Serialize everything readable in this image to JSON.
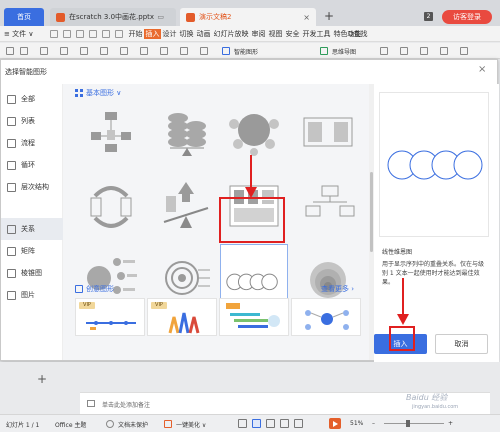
{
  "titlebar": {
    "tabs": [
      {
        "label": "首页"
      },
      {
        "label": "在scratch 3.0中画花.pptx"
      },
      {
        "label": "演示文稿2"
      }
    ],
    "badge": "2",
    "login": "访客登录"
  },
  "menubar": {
    "file": "≡ 文件 ∨",
    "tabs": [
      "开始",
      "插入",
      "设计",
      "切换",
      "动画",
      "幻灯片放映",
      "审阅",
      "视图",
      "安全",
      "开发工具",
      "特色功能"
    ],
    "search": "Q查找"
  },
  "toolbar": {
    "items": [
      "智能图形",
      "思维导图"
    ]
  },
  "dialog": {
    "title": "选择智能图形",
    "sidebar": [
      {
        "label": "全部"
      },
      {
        "label": "列表"
      },
      {
        "label": "流程"
      },
      {
        "label": "循环"
      },
      {
        "label": "层次结构"
      },
      {
        "label": "关系"
      },
      {
        "label": "矩阵"
      },
      {
        "label": "棱锥图"
      },
      {
        "label": "图片"
      }
    ],
    "basic_section": "基本图形 ∨",
    "creative_section": "创意图形",
    "see_more": "查看更多 ›",
    "vip": "VIP",
    "preview_title": "线性维恩图",
    "preview_desc": "用于显示序列中的重叠关系。仅在与级别 1 文本一起使用时才能达到最佳效果。",
    "insert": "插入",
    "cancel": "取消"
  },
  "editor": {
    "notes_placeholder": "单击此处添加备注"
  },
  "statusbar": {
    "slide": "幻灯片 1 / 1",
    "theme": "Office 主题",
    "protect": "文档未保护",
    "beautify": "一键美化 ∨",
    "zoom": "51%"
  },
  "watermark": {
    "text": "Baidu 经验",
    "sub": "jingyan.baidu.com"
  }
}
